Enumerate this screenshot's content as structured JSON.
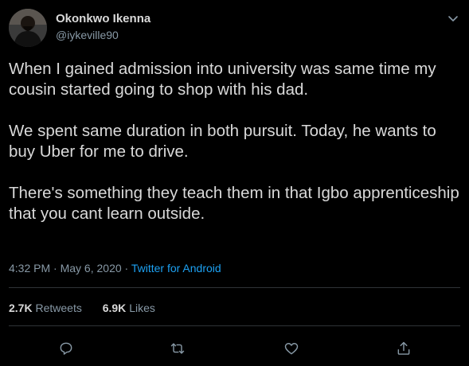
{
  "author": {
    "name": "Okonkwo Ikenna",
    "handle": "@iykeville90"
  },
  "tweet": {
    "paragraphs": [
      "When I gained admission into university was same time my cousin started going to shop with his dad.",
      "We spent same duration in both pursuit. Today, he wants to buy Uber for me to drive.",
      "There's something they teach them in that Igbo apprenticeship that you cant learn outside."
    ],
    "time": "4:32 PM",
    "separator": "·",
    "date": "May 6, 2020",
    "source": "Twitter for Android"
  },
  "stats": {
    "retweets_count": "2.7K",
    "retweets_label": "Retweets",
    "likes_count": "6.9K",
    "likes_label": "Likes"
  },
  "icons": {
    "more": "chevron-down-icon",
    "reply": "reply-icon",
    "retweet": "retweet-icon",
    "like": "heart-icon",
    "share": "share-icon"
  },
  "colors": {
    "background": "#000000",
    "text": "#d9d9d9",
    "secondary": "#8899a6",
    "accent": "#1da1f2",
    "divider": "#2f3336"
  }
}
